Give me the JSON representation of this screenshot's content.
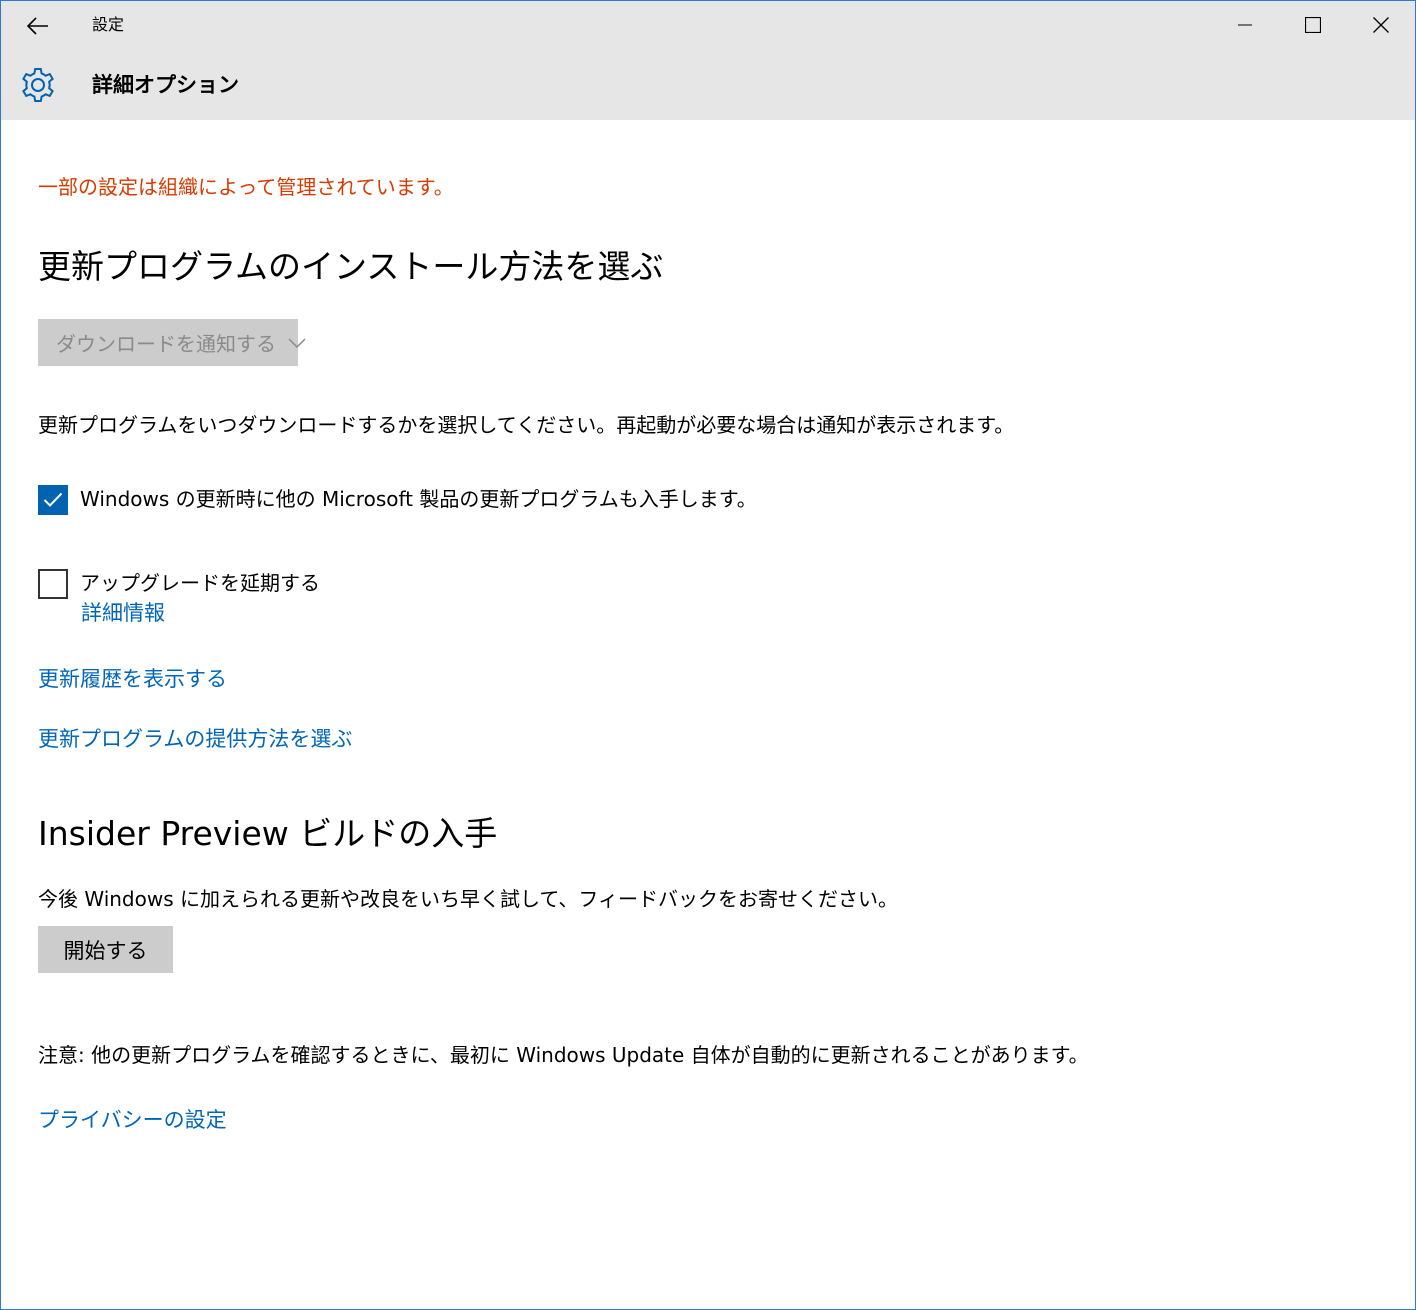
{
  "titlebar": {
    "app_title": "設定",
    "page_title": "詳細オプション"
  },
  "managed_notice": "一部の設定は組織によって管理されています。",
  "install_section": {
    "title": "更新プログラムのインストール方法を選ぶ",
    "dropdown_value": "ダウンロードを通知する",
    "description": "更新プログラムをいつダウンロードするかを選択してください。再起動が必要な場合は通知が表示されます。"
  },
  "options": {
    "microsoft_products": {
      "label": "Windows の更新時に他の Microsoft 製品の更新プログラムも入手します。",
      "checked": true
    },
    "defer_upgrades": {
      "label": "アップグレードを延期する",
      "checked": false,
      "more_info_link": "詳細情報"
    }
  },
  "links": {
    "update_history": "更新履歴を表示する",
    "delivery_method": "更新プログラムの提供方法を選ぶ"
  },
  "insider_section": {
    "title": "Insider Preview ビルドの入手",
    "description": "今後 Windows に加えられる更新や改良をいち早く試して、フィードバックをお寄せください。",
    "button_label": "開始する"
  },
  "note": "注意: 他の更新プログラムを確認するときに、最初に Windows Update 自体が自動的に更新されることがあります。",
  "privacy_link": "プライバシーの設定",
  "colors": {
    "accent": "#0063b1",
    "link": "#0067b8",
    "warning": "#d83b01",
    "titlebar": "#e6e6e6",
    "button": "#cccccc"
  }
}
